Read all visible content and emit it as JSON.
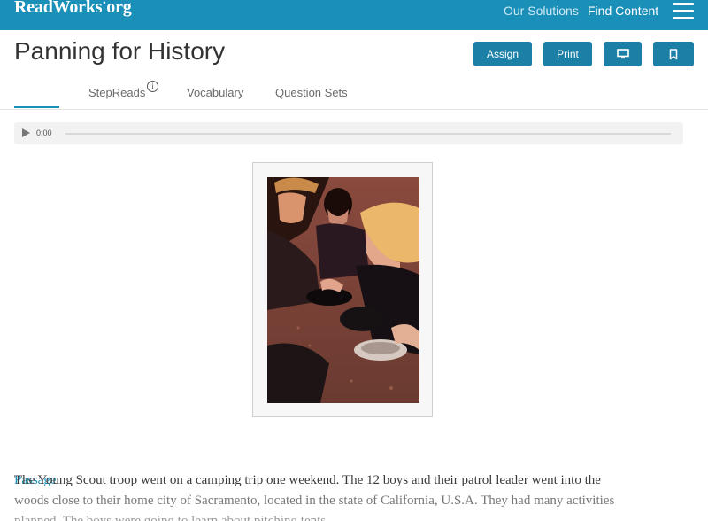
{
  "header": {
    "logo_main": "ReadWorks",
    "logo_dot": "•",
    "logo_tld": "org",
    "nav": [
      "Our Solutions",
      "Find Content"
    ],
    "menu_icon": "hamburger-icon"
  },
  "title": "Panning for History",
  "actions": {
    "assign": "Assign",
    "print": "Print",
    "monitor_icon": "monitor-icon",
    "bookmark_icon": "bookmark-icon"
  },
  "tabs": [
    {
      "label": "Passage",
      "active": true
    },
    {
      "label": "StepReads",
      "info": "i"
    },
    {
      "label": "Vocabulary"
    },
    {
      "label": "Question Sets"
    }
  ],
  "audio": {
    "time": "0:00",
    "progress": 0
  },
  "passage": {
    "line1": "The Young Scout troop went on a camping trip one weekend. The 12 boys and their patrol leader went into the",
    "line2": "woods close to their home city of Sacramento, located in the state of California, U.S.A. They had many activities",
    "line3": "planned. The boys were going to learn about pitching tents"
  },
  "colors": {
    "brand": "#1a8fb8",
    "button": "#1b7fa6"
  }
}
